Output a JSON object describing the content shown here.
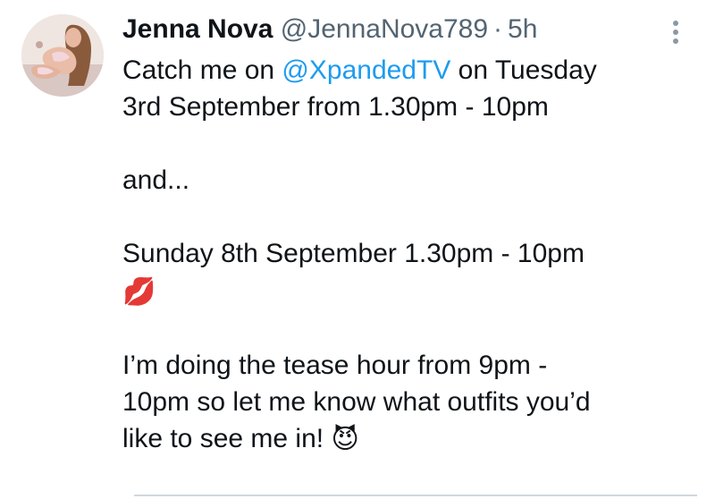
{
  "tweet": {
    "author": {
      "display_name": "Jenna Nova",
      "handle": "@JennaNova789",
      "separator": "·",
      "time": "5h",
      "avatar_icon": "profile-photo"
    },
    "more_icon": "more-vertical-icon",
    "lines": {
      "l1_pre": "Catch me on ",
      "l1_mention": "@XpandedTV",
      "l1_post": " on Tuesday",
      "l2": "3rd September from 1.30pm - 10pm",
      "l3": "and...",
      "l4": "Sunday 8th September 1.30pm - 10pm",
      "l5_emoji": "💋",
      "l6": "I’m doing the tease hour from 9pm -",
      "l7": "10pm so let me know what outfits you’d",
      "l8_text": "like to see me in! ",
      "l8_emoji": "😈"
    },
    "colors": {
      "text": "#0f1419",
      "secondary": "#536471",
      "link": "#1d9bf0"
    }
  }
}
